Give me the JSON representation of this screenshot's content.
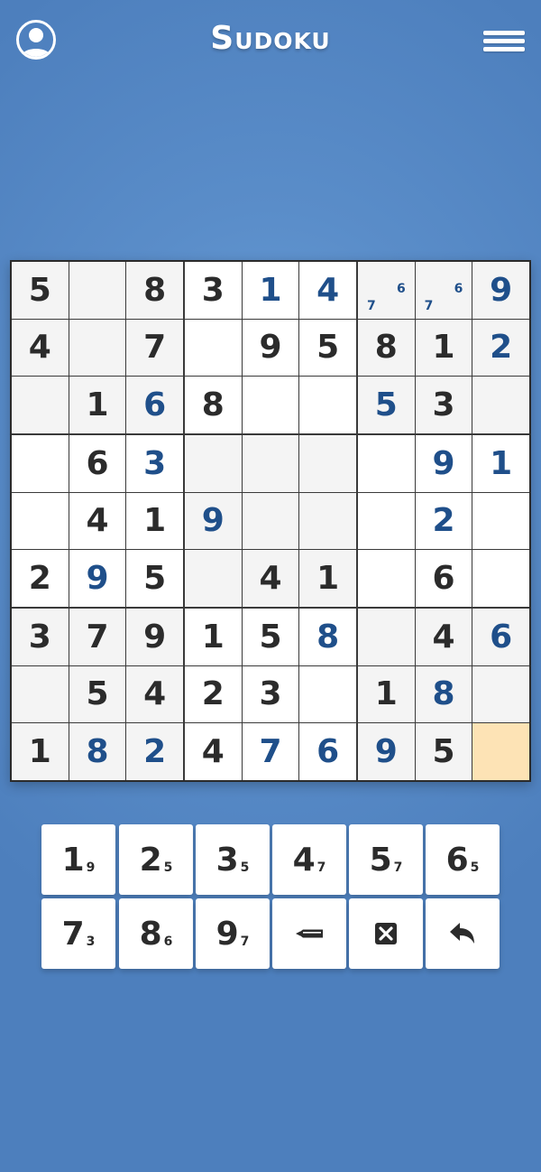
{
  "header": {
    "title": "Sudoku"
  },
  "colors": {
    "background": "#5a8dc9",
    "given_digit": "#2b2b2b",
    "user_digit": "#1f4f8a",
    "highlight_cell": "#fde3b5",
    "shaded_cell": "#f4f4f4",
    "plain_cell": "#ffffff"
  },
  "board": {
    "rows": [
      [
        {
          "v": "5",
          "t": "g"
        },
        {
          "v": "",
          "t": "e"
        },
        {
          "v": "8",
          "t": "g"
        },
        {
          "v": "3",
          "t": "g"
        },
        {
          "v": "1",
          "t": "u"
        },
        {
          "v": "4",
          "t": "u"
        },
        {
          "v": "",
          "t": "n",
          "notes": [
            "7",
            "6"
          ]
        },
        {
          "v": "",
          "t": "n",
          "notes": [
            "7",
            "6"
          ]
        },
        {
          "v": "9",
          "t": "u"
        }
      ],
      [
        {
          "v": "4",
          "t": "g"
        },
        {
          "v": "",
          "t": "e"
        },
        {
          "v": "7",
          "t": "g"
        },
        {
          "v": "",
          "t": "e"
        },
        {
          "v": "9",
          "t": "g"
        },
        {
          "v": "5",
          "t": "g"
        },
        {
          "v": "8",
          "t": "g"
        },
        {
          "v": "1",
          "t": "g"
        },
        {
          "v": "2",
          "t": "u"
        }
      ],
      [
        {
          "v": "",
          "t": "e"
        },
        {
          "v": "1",
          "t": "g"
        },
        {
          "v": "6",
          "t": "u"
        },
        {
          "v": "8",
          "t": "g"
        },
        {
          "v": "",
          "t": "e"
        },
        {
          "v": "",
          "t": "e"
        },
        {
          "v": "5",
          "t": "u"
        },
        {
          "v": "3",
          "t": "g"
        },
        {
          "v": "",
          "t": "e"
        }
      ],
      [
        {
          "v": "",
          "t": "e"
        },
        {
          "v": "6",
          "t": "g"
        },
        {
          "v": "3",
          "t": "u"
        },
        {
          "v": "",
          "t": "e"
        },
        {
          "v": "",
          "t": "e"
        },
        {
          "v": "",
          "t": "e"
        },
        {
          "v": "",
          "t": "e"
        },
        {
          "v": "9",
          "t": "u"
        },
        {
          "v": "1",
          "t": "u"
        }
      ],
      [
        {
          "v": "",
          "t": "e"
        },
        {
          "v": "4",
          "t": "g"
        },
        {
          "v": "1",
          "t": "g"
        },
        {
          "v": "9",
          "t": "u"
        },
        {
          "v": "",
          "t": "e"
        },
        {
          "v": "",
          "t": "e"
        },
        {
          "v": "",
          "t": "e"
        },
        {
          "v": "2",
          "t": "u"
        },
        {
          "v": "",
          "t": "e"
        }
      ],
      [
        {
          "v": "2",
          "t": "g"
        },
        {
          "v": "9",
          "t": "u"
        },
        {
          "v": "5",
          "t": "g"
        },
        {
          "v": "",
          "t": "e"
        },
        {
          "v": "4",
          "t": "g"
        },
        {
          "v": "1",
          "t": "g"
        },
        {
          "v": "",
          "t": "e"
        },
        {
          "v": "6",
          "t": "g"
        },
        {
          "v": "",
          "t": "e"
        }
      ],
      [
        {
          "v": "3",
          "t": "g"
        },
        {
          "v": "7",
          "t": "g"
        },
        {
          "v": "9",
          "t": "g"
        },
        {
          "v": "1",
          "t": "g"
        },
        {
          "v": "5",
          "t": "g"
        },
        {
          "v": "8",
          "t": "u"
        },
        {
          "v": "",
          "t": "e"
        },
        {
          "v": "4",
          "t": "g"
        },
        {
          "v": "6",
          "t": "u"
        }
      ],
      [
        {
          "v": "",
          "t": "e"
        },
        {
          "v": "5",
          "t": "g"
        },
        {
          "v": "4",
          "t": "g"
        },
        {
          "v": "2",
          "t": "g"
        },
        {
          "v": "3",
          "t": "g"
        },
        {
          "v": "",
          "t": "e"
        },
        {
          "v": "1",
          "t": "g"
        },
        {
          "v": "8",
          "t": "u"
        },
        {
          "v": "",
          "t": "e"
        }
      ],
      [
        {
          "v": "1",
          "t": "g"
        },
        {
          "v": "8",
          "t": "u"
        },
        {
          "v": "2",
          "t": "u"
        },
        {
          "v": "4",
          "t": "g"
        },
        {
          "v": "7",
          "t": "u"
        },
        {
          "v": "6",
          "t": "u"
        },
        {
          "v": "9",
          "t": "u"
        },
        {
          "v": "5",
          "t": "g"
        },
        {
          "v": "",
          "t": "e"
        }
      ]
    ],
    "shaded": [
      [
        1,
        1,
        1,
        0,
        0,
        0,
        1,
        1,
        1
      ],
      [
        1,
        1,
        1,
        0,
        0,
        0,
        1,
        1,
        1
      ],
      [
        1,
        1,
        1,
        0,
        0,
        0,
        1,
        1,
        1
      ],
      [
        0,
        0,
        0,
        1,
        1,
        1,
        0,
        0,
        0
      ],
      [
        0,
        0,
        0,
        1,
        1,
        1,
        0,
        0,
        0
      ],
      [
        0,
        0,
        0,
        1,
        1,
        1,
        0,
        0,
        0
      ],
      [
        1,
        1,
        1,
        0,
        0,
        0,
        1,
        1,
        1
      ],
      [
        1,
        1,
        1,
        0,
        0,
        0,
        1,
        1,
        1
      ],
      [
        1,
        1,
        1,
        0,
        0,
        0,
        1,
        1,
        1
      ]
    ],
    "selected": {
      "row": 8,
      "col": 8
    }
  },
  "keypad": {
    "digits": [
      {
        "digit": "1",
        "remaining": "9"
      },
      {
        "digit": "2",
        "remaining": "5"
      },
      {
        "digit": "3",
        "remaining": "5"
      },
      {
        "digit": "4",
        "remaining": "7"
      },
      {
        "digit": "5",
        "remaining": "7"
      },
      {
        "digit": "6",
        "remaining": "5"
      },
      {
        "digit": "7",
        "remaining": "3"
      },
      {
        "digit": "8",
        "remaining": "6"
      },
      {
        "digit": "9",
        "remaining": "7"
      }
    ],
    "tools": [
      {
        "icon": "pencil-icon",
        "name": "notes-button"
      },
      {
        "icon": "erase-icon",
        "name": "erase-button"
      },
      {
        "icon": "undo-icon",
        "name": "undo-button"
      }
    ]
  }
}
